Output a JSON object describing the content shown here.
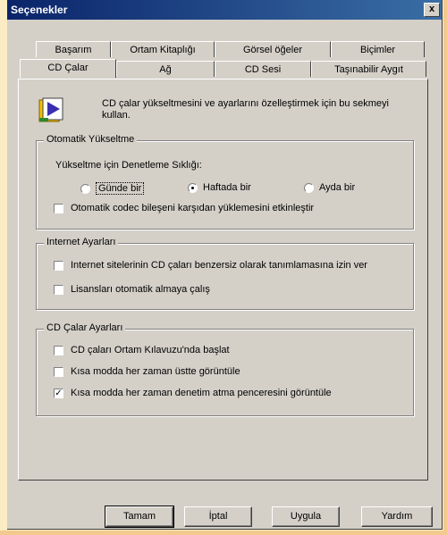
{
  "window": {
    "title": "Seçenekler",
    "close": "x"
  },
  "tabs_back": [
    "Başarım",
    "Ortam Kitaplığı",
    "Görsel öğeler",
    "Biçimler"
  ],
  "tabs_front": [
    "CD Çalar",
    "Ağ",
    "CD Sesi",
    "Taşınabilir Aygıt"
  ],
  "intro": "CD çalar yükseltmesini ve ayarlarını özelleştirmek için bu sekmeyi kullan.",
  "auto_upgrade": {
    "title": "Otomatik Yükseltme",
    "freq_label": "Yükseltme için Denetleme Sıklığı:",
    "options": [
      "Günde bir",
      "Haftada bir",
      "Ayda bir"
    ],
    "selected": "Haftada bir",
    "codec_label": "Otomatik codec bileşeni karşıdan yüklemesini etkinleştir",
    "codec_checked": false
  },
  "internet": {
    "title": "Internet Ayarları",
    "items": [
      {
        "label": "Internet sitelerinin CD çaları benzersiz olarak tanımlamasına izin ver",
        "checked": false
      },
      {
        "label": "Lisansları otomatik almaya çalış",
        "checked": false
      }
    ]
  },
  "cd_player": {
    "title": "CD Çalar Ayarları",
    "items": [
      {
        "label": "CD çaları Ortam Kılavuzu'nda başlat",
        "checked": false
      },
      {
        "label": "Kısa modda her zaman üstte görüntüle",
        "checked": false
      },
      {
        "label": "Kısa modda her zaman denetim atma penceresini görüntüle",
        "checked": true
      }
    ]
  },
  "buttons": {
    "ok": "Tamam",
    "cancel": "İptal",
    "apply": "Uygula",
    "help": "Yardım"
  },
  "colors": {
    "title_start": "#0a246a",
    "title_end": "#3a6ea5",
    "face": "#d4d0c8",
    "page_bg": "#fbecc4"
  },
  "icons": {
    "app": "cd-player-play-icon"
  }
}
